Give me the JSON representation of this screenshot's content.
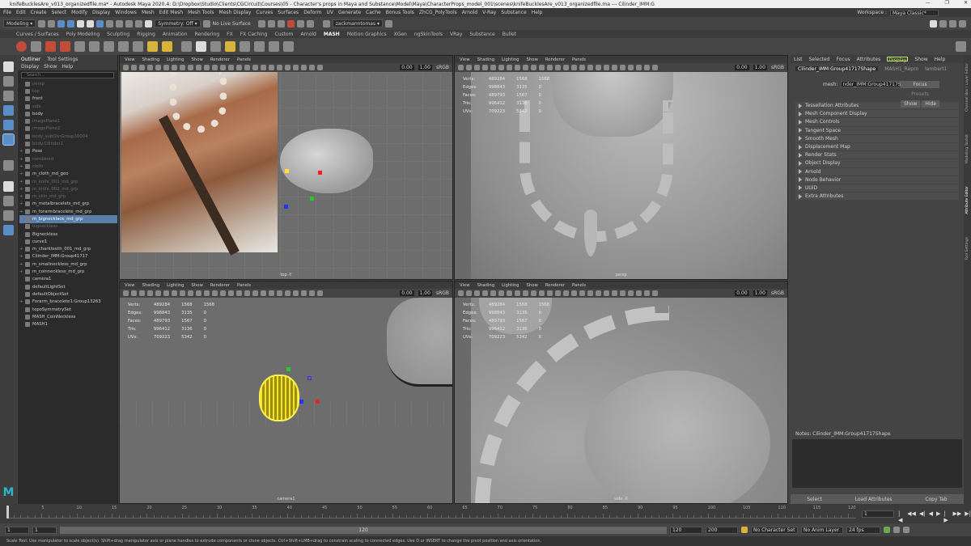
{
  "window": {
    "title": "knifeBucklesAre_v013_organizedfile.ma* - Autodesk Maya 2020.4: D:\\Dropbox\\Studio\\Clients\\CGCircuit\\Courses\\05 - Character's props in Maya and Substance\\Model\\Maya\\CharacterProps_model_001\\scenes\\knifeBucklesAre_v013_organizedfile.ma  ---  Cilinder_IMM:G",
    "controls": [
      "—",
      "❐",
      "✕"
    ]
  },
  "menubar": {
    "items": [
      "File",
      "Edit",
      "Create",
      "Select",
      "Modify",
      "Display",
      "Windows",
      "Mesh",
      "Edit Mesh",
      "Mesh Tools",
      "Mesh Display",
      "Curves",
      "Surfaces",
      "Deform",
      "UV",
      "Generate",
      "Cache",
      "Bonus Tools",
      "ZhCG_PolyTools",
      "Arnold",
      "V-Ray",
      "Substance",
      "Help"
    ],
    "workspace_label": "Workspace :",
    "workspace_value": "Maya Classic*"
  },
  "statusline": {
    "mode": "Modeling",
    "symmetry": "Symmetry: Off",
    "live_surface": "No Live Surface",
    "user": "zackmanntomas"
  },
  "shelf_tabs": {
    "items": [
      "Curves / Surfaces",
      "Poly Modeling",
      "Sculpting",
      "Rigging",
      "Animation",
      "Rendering",
      "FX",
      "FX Caching",
      "Custom",
      "Arnold",
      "MASH",
      "Motion Graphics",
      "XGen",
      "ngSkinTools",
      "VRay",
      "Substance",
      "Bullet"
    ],
    "active": "MASH"
  },
  "outliner": {
    "tabs": [
      "Outliner",
      "Tool Settings"
    ],
    "menu": [
      "Display",
      "Show",
      "Help"
    ],
    "search_placeholder": "Search...",
    "items": [
      {
        "label": "persp",
        "dim": true,
        "exp": ""
      },
      {
        "label": "top",
        "dim": true,
        "exp": ""
      },
      {
        "label": "front",
        "dim": false,
        "exp": ""
      },
      {
        "label": "side",
        "dim": true,
        "exp": ""
      },
      {
        "label": "body",
        "dim": false,
        "exp": ""
      },
      {
        "label": "imagePlane1",
        "dim": true,
        "exp": ""
      },
      {
        "label": "imagePlane2",
        "dim": true,
        "exp": ""
      },
      {
        "label": "body_subDiv:Group30004",
        "dim": true,
        "exp": ""
      },
      {
        "label": "body:Cilinder1",
        "dim": true,
        "exp": ""
      },
      {
        "label": "Pose",
        "dim": false,
        "exp": "+"
      },
      {
        "label": "combined",
        "dim": true,
        "exp": "+"
      },
      {
        "label": "cloth",
        "dim": true,
        "exp": "+"
      },
      {
        "label": "m_cloth_md_geo",
        "dim": false,
        "exp": "+"
      },
      {
        "label": "m_knife_001_md_grp",
        "dim": true,
        "exp": "+"
      },
      {
        "label": "m_knife_002_md_grp",
        "dim": true,
        "exp": "+"
      },
      {
        "label": "m_skin_md_grp",
        "dim": true,
        "exp": "+"
      },
      {
        "label": "m_metalbracelets_md_grp",
        "dim": false,
        "exp": "+"
      },
      {
        "label": "m_forarmbracelete_md_grp",
        "dim": false,
        "exp": "+"
      },
      {
        "label": "m_bignecklace_md_grp",
        "dim": false,
        "exp": "−",
        "sel": true
      },
      {
        "label": "bigneckless",
        "dim": true,
        "exp": ""
      },
      {
        "label": "Bigneckless",
        "dim": false,
        "exp": ""
      },
      {
        "label": "curve1",
        "dim": false,
        "exp": ""
      },
      {
        "label": "m_charkteeth_001_md_grp",
        "dim": false,
        "exp": "+"
      },
      {
        "label": "Cilinder_IMM:Group41717",
        "dim": false,
        "exp": "+"
      },
      {
        "label": "m_smallneckless_md_grp",
        "dim": false,
        "exp": "+"
      },
      {
        "label": "m_coinneckless_md_grp",
        "dim": false,
        "exp": "+"
      },
      {
        "label": "camera1",
        "dim": false,
        "exp": ""
      },
      {
        "label": "defaultLightSet",
        "dim": false,
        "exp": ""
      },
      {
        "label": "defaultObjectSet",
        "dim": false,
        "exp": ""
      },
      {
        "label": "Forarm_bracelete1:Group13263",
        "dim": false,
        "exp": "+"
      },
      {
        "label": "topoSymmetrySet",
        "dim": false,
        "exp": ""
      },
      {
        "label": "MASH_CoinNeckless",
        "dim": false,
        "exp": ""
      },
      {
        "label": "MASH1",
        "dim": false,
        "exp": ""
      }
    ]
  },
  "viewport_menu": [
    "View",
    "Shading",
    "Lighting",
    "Show",
    "Renderer",
    "Panels"
  ],
  "viewports": {
    "top": {
      "label": "top -Y",
      "num1": "0.00",
      "num2": "1.00",
      "colorspace": "sRGB"
    },
    "persp": {
      "label": "persp",
      "num1": "0.00",
      "num2": "1.00",
      "colorspace": "sRGB"
    },
    "camera": {
      "label": "camera1",
      "num1": "0.00",
      "num2": "1.00",
      "colorspace": "sRGB"
    },
    "side": {
      "label": "side -X",
      "num1": "0.00",
      "num2": "1.00",
      "colorspace": "sRGB"
    }
  },
  "hud": {
    "rows": [
      {
        "k": "Verts:",
        "a": "489284",
        "b": "1568",
        "c": "1568"
      },
      {
        "k": "Edges:",
        "a": "998843",
        "b": "3135",
        "c": "0"
      },
      {
        "k": "Faces:",
        "a": "489793",
        "b": "1567",
        "c": "0"
      },
      {
        "k": "Tris:",
        "a": "996412",
        "b": "3136",
        "c": "0"
      },
      {
        "k": "UVs:",
        "a": "709223",
        "b": "5342",
        "c": "0"
      }
    ]
  },
  "attribute_editor": {
    "menu": [
      "List",
      "Selected",
      "Focus",
      "Attributes",
      "Display",
      "Show",
      "Help"
    ],
    "highlight": "Display",
    "tabs": [
      "Cilinder_IMM:Group41717Shape",
      "MASH1_Repro",
      "lambert1"
    ],
    "mesh_label": "mesh:",
    "mesh_value": "nder_IMM:Group41717Shape",
    "focus": "Focus",
    "presets": "Presets",
    "show": "Show",
    "hide": "Hide",
    "sections": [
      "Tessellation Attributes",
      "Mesh Component Display",
      "Mesh Controls",
      "Tangent Space",
      "Smooth Mesh",
      "Displacement Map",
      "Render Stats",
      "Object Display",
      "Arnold",
      "Node Behavior",
      "UUID",
      "Extra Attributes"
    ],
    "notes_label": "Notes: Cilinder_IMM:Group41717Shape",
    "footer": [
      "Select",
      "Load Attributes",
      "Copy Tab"
    ]
  },
  "right_tabs": [
    "Channel Box / Layer Editor",
    "Modeling Toolkit",
    "Attribute Editor",
    "Tool Settings"
  ],
  "timeline": {
    "ticks": [
      "1",
      "5",
      "10",
      "15",
      "20",
      "25",
      "30",
      "35",
      "40",
      "45",
      "50",
      "55",
      "60",
      "65",
      "70",
      "75",
      "80",
      "85",
      "90",
      "95",
      "100",
      "105",
      "110",
      "115",
      "120"
    ],
    "current_frame": "1",
    "playback": [
      "|◀",
      "◀◀",
      "◀|",
      "◀",
      "▶",
      "|▶",
      "▶▶",
      "▶|"
    ]
  },
  "range": {
    "start": "1",
    "start2": "1",
    "mid": "120",
    "end1": "120",
    "end2": "200",
    "character_set": "No Character Set",
    "anim_layer": "No Anim Layer",
    "fps": "24 fps"
  },
  "helpline": "Scale Tool: Use manipulator to scale object(s). Shift+drag manipulator axis or plane handles to extrude components or clone objects. Ctrl+Shift+LMB+drag to constrain scaling to connected edges. Use D or INSERT to change the pivot position and axis orientation."
}
